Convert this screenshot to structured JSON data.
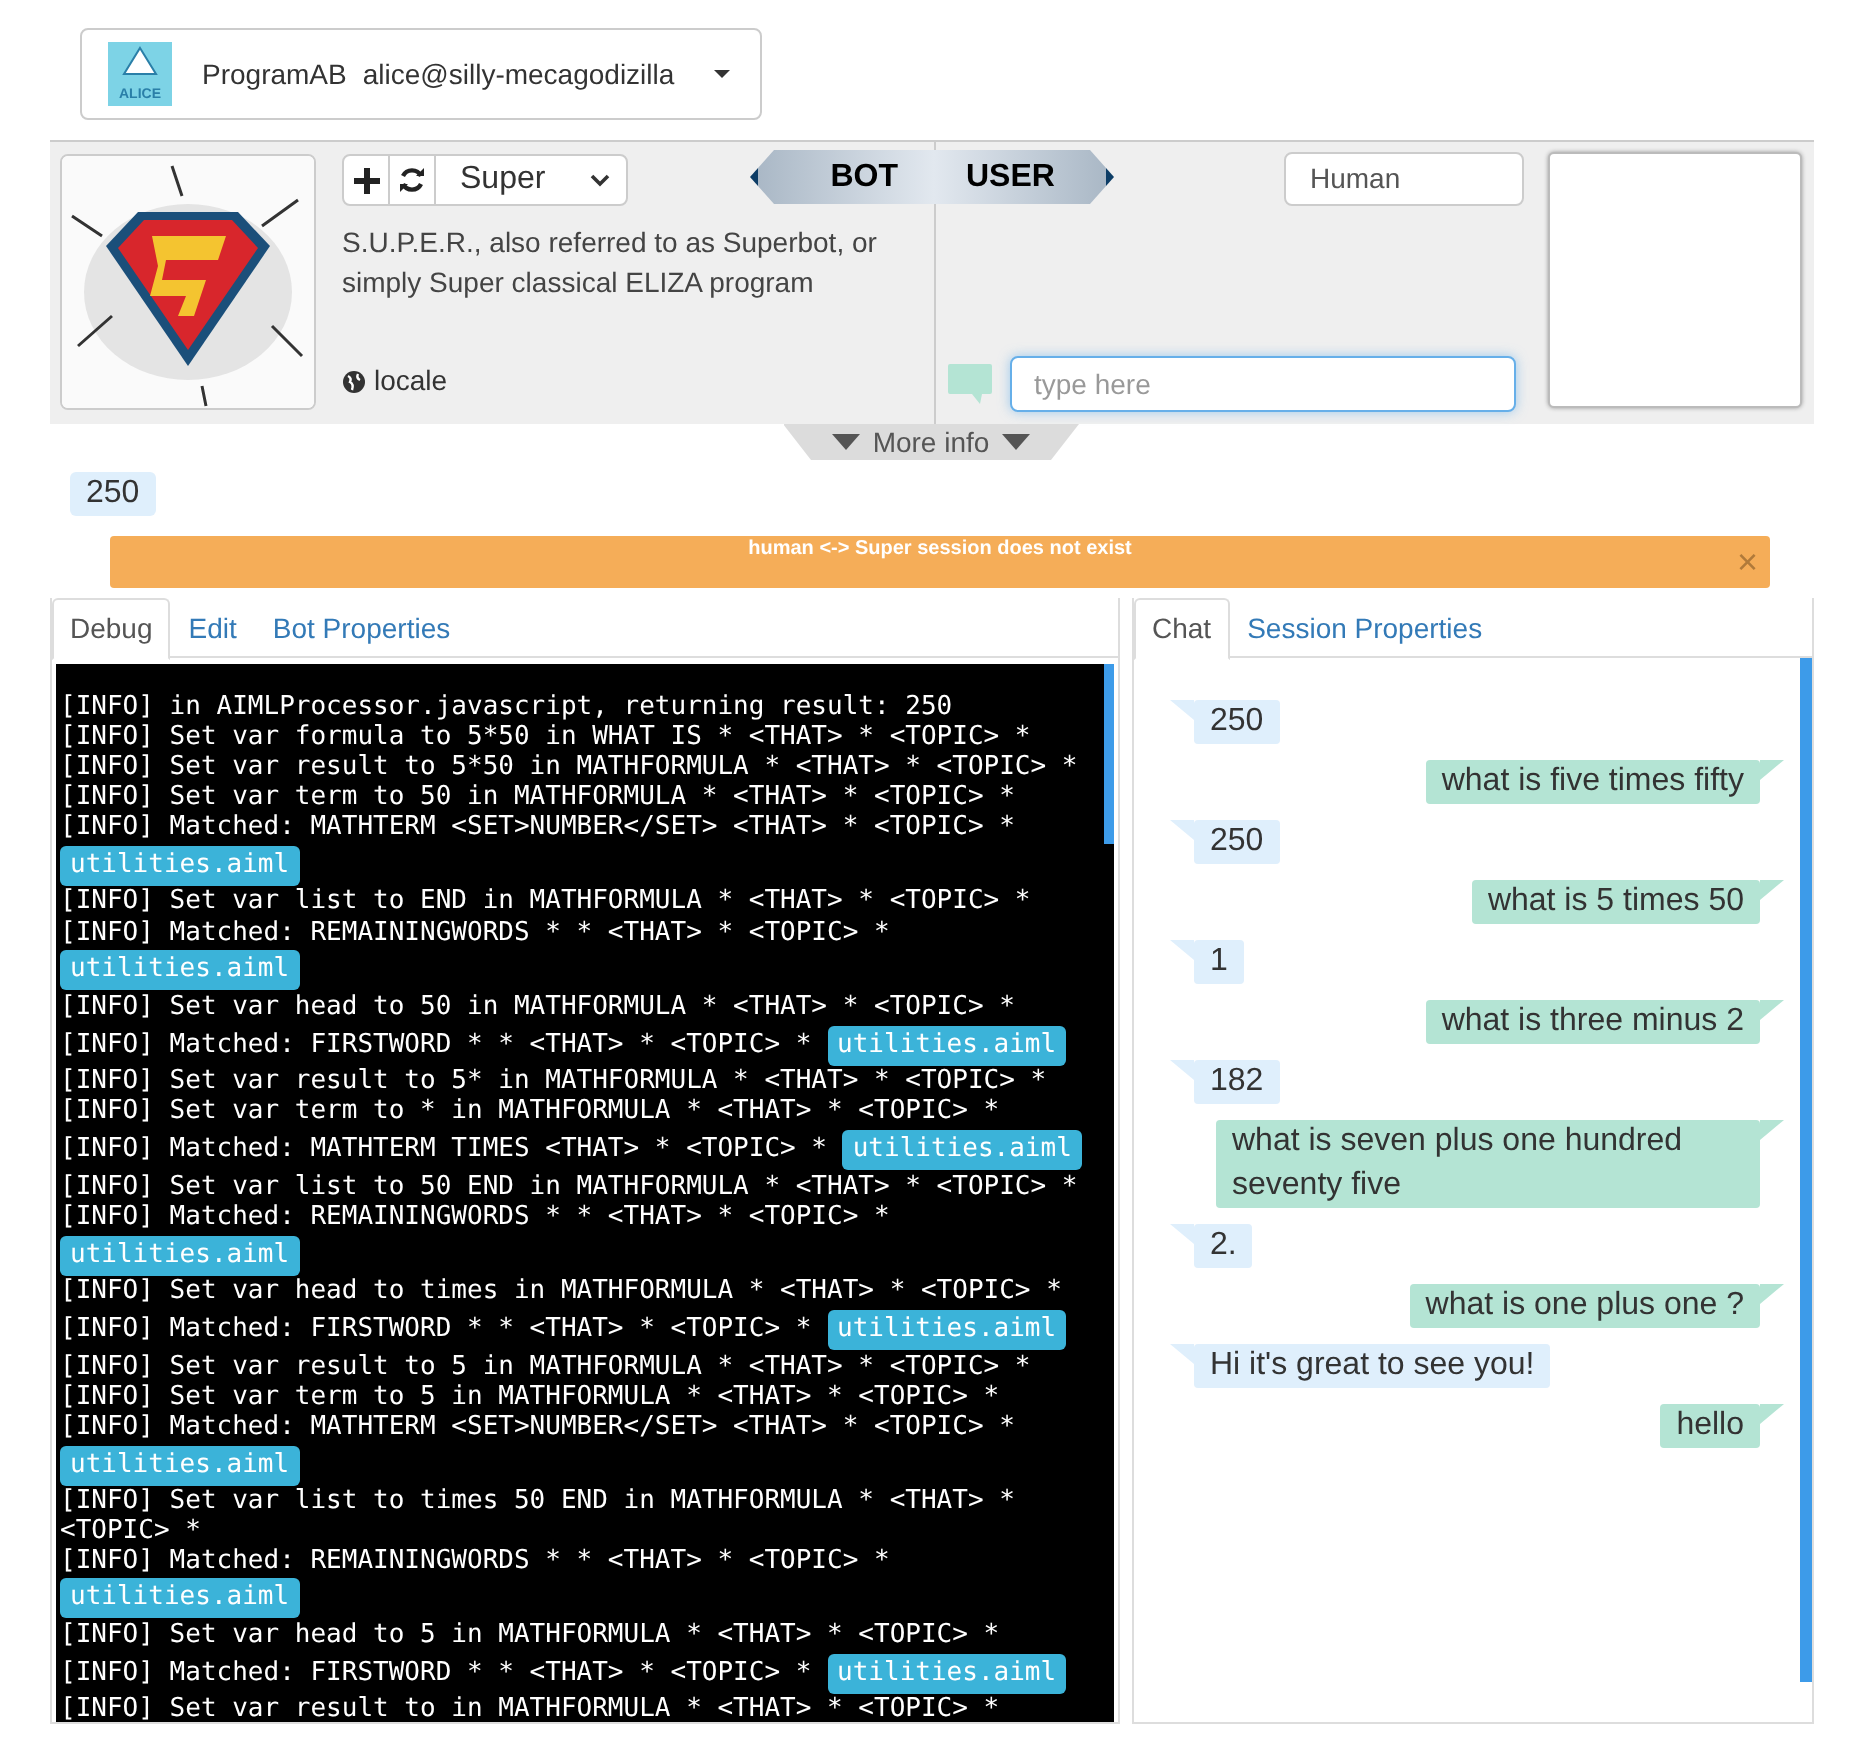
{
  "account": {
    "logo_text": "ALICE",
    "program": "ProgramAB",
    "user": "alice@silly-mecagodizilla"
  },
  "bot": {
    "selected_bot": "Super",
    "description": "S.U.P.E.R., also referred to as Superbot, or simply Super classical ELIZA program",
    "locale": "locale"
  },
  "banner": {
    "bot": "BOT",
    "user": "USER"
  },
  "user": {
    "name": "Human",
    "input_placeholder": "type here"
  },
  "more_info": "More info",
  "last_reply": "250",
  "alert": {
    "text": "human <-> Super session does not exist",
    "close": "×"
  },
  "left_tabs": [
    {
      "label": "Debug",
      "selected": true
    },
    {
      "label": "Edit",
      "selected": false
    },
    {
      "label": "Bot Properties",
      "selected": false
    }
  ],
  "debug_log": [
    {
      "text": "[INFO] in AIMLProcessor.javascript, returning result: 250"
    },
    {
      "text": "[INFO] Set var formula to 5*50 in WHAT IS * <THAT> * <TOPIC> *"
    },
    {
      "text": "[INFO] Set var result to 5*50 in MATHFORMULA * <THAT> * <TOPIC> *"
    },
    {
      "text": "[INFO] Set var term to 50 in MATHFORMULA * <THAT> * <TOPIC> *"
    },
    {
      "text": "[INFO] Matched: MATHTERM <SET>NUMBER</SET> <THAT> * <TOPIC> *",
      "file": "utilities.aiml"
    },
    {
      "text": "[INFO] Set var list to END in MATHFORMULA * <THAT> * <TOPIC> *"
    },
    {
      "text": "[INFO] Matched: REMAININGWORDS * * <THAT> * <TOPIC> *",
      "file": "utilities.aiml"
    },
    {
      "text": "[INFO] Set var head to 50 in MATHFORMULA * <THAT> * <TOPIC> *"
    },
    {
      "text": "[INFO] Matched: FIRSTWORD * * <THAT> * <TOPIC> *",
      "file": "utilities.aiml"
    },
    {
      "text": "[INFO] Set var result to 5* in MATHFORMULA * <THAT> * <TOPIC> *"
    },
    {
      "text": "[INFO] Set var term to * in MATHFORMULA * <THAT> * <TOPIC> *"
    },
    {
      "text": "[INFO] Matched: MATHTERM TIMES <THAT> * <TOPIC> *",
      "file": "utilities.aiml"
    },
    {
      "text": "[INFO] Set var list to 50 END in MATHFORMULA * <THAT> * <TOPIC> *"
    },
    {
      "text": "[INFO] Matched: REMAININGWORDS * * <THAT> * <TOPIC> *",
      "file": "utilities.aiml"
    },
    {
      "text": "[INFO] Set var head to times in MATHFORMULA * <THAT> * <TOPIC> *"
    },
    {
      "text": "[INFO] Matched: FIRSTWORD * * <THAT> * <TOPIC> *",
      "file": "utilities.aiml"
    },
    {
      "text": "[INFO] Set var result to 5 in MATHFORMULA * <THAT> * <TOPIC> *"
    },
    {
      "text": "[INFO] Set var term to 5 in MATHFORMULA * <THAT> * <TOPIC> *"
    },
    {
      "text": "[INFO] Matched: MATHTERM <SET>NUMBER</SET> <THAT> * <TOPIC> *",
      "file": "utilities.aiml"
    },
    {
      "text": "[INFO] Set var list to times 50 END in MATHFORMULA * <THAT> * <TOPIC> *"
    },
    {
      "text": "[INFO] Matched: REMAININGWORDS * * <THAT> * <TOPIC> *",
      "file": "utilities.aiml"
    },
    {
      "text": "[INFO] Set var head to 5 in MATHFORMULA * <THAT> * <TOPIC> *"
    },
    {
      "text": "[INFO] Matched: FIRSTWORD * * <THAT> * <TOPIC> *",
      "file": "utilities.aiml"
    },
    {
      "text": "[INFO] Set var result to in MATHFORMULA * <THAT> * <TOPIC> *"
    }
  ],
  "right_tabs": [
    {
      "label": "Chat",
      "selected": true
    },
    {
      "label": "Session Properties",
      "selected": false
    }
  ],
  "chat": [
    {
      "kind": "bot",
      "text": "250"
    },
    {
      "kind": "user",
      "text": "what is five times fifty"
    },
    {
      "kind": "bot",
      "text": "250"
    },
    {
      "kind": "user",
      "text": "what is 5 times 50"
    },
    {
      "kind": "bot",
      "text": "1"
    },
    {
      "kind": "user",
      "text": "what is three minus 2"
    },
    {
      "kind": "bot",
      "text": "182"
    },
    {
      "kind": "user",
      "text": "what is seven plus one hundred seventy five"
    },
    {
      "kind": "bot",
      "text": "2."
    },
    {
      "kind": "user",
      "text": "what is one plus one ?"
    },
    {
      "kind": "bot",
      "text": "Hi it's great to see you!"
    },
    {
      "kind": "user",
      "text": "hello"
    }
  ]
}
